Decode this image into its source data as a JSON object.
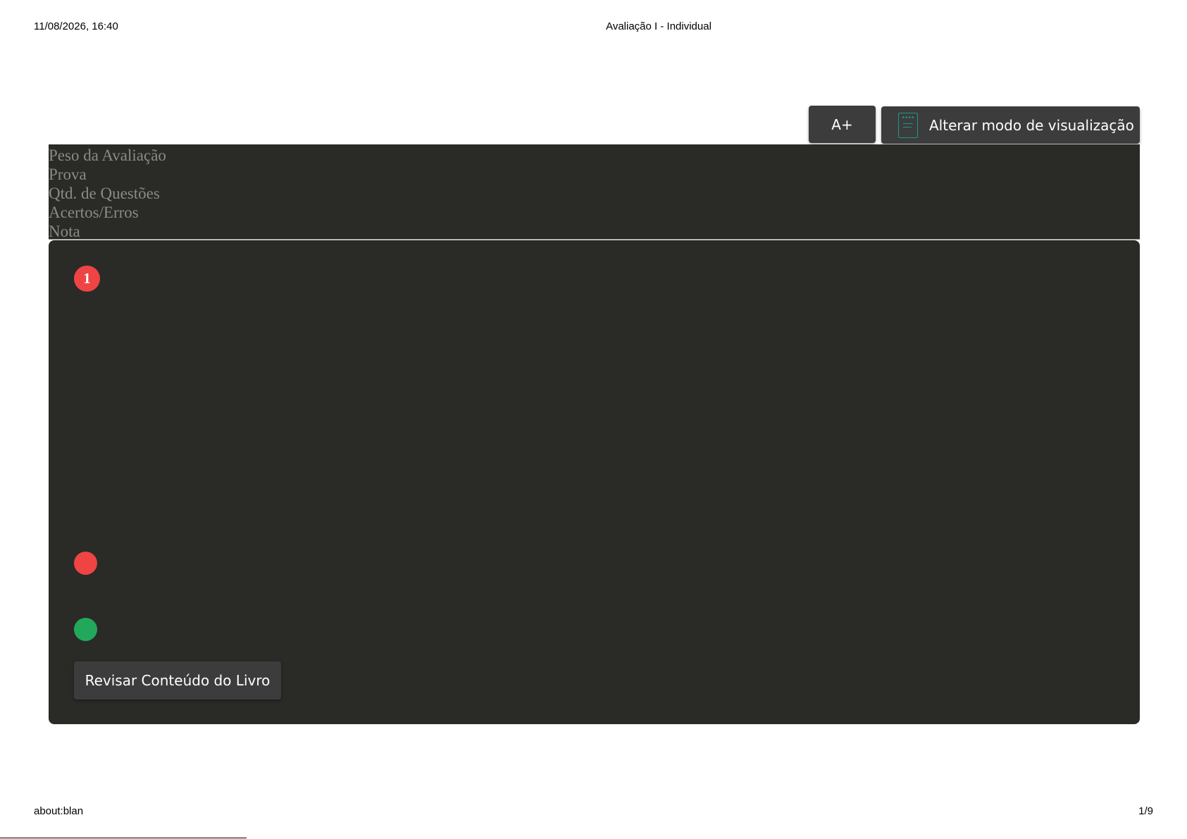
{
  "print_header": {
    "datetime": "11/08/2026, 16:40",
    "title": "Avaliação I - Individual"
  },
  "toolbar": {
    "font_size_label": "A+",
    "view_mode_label": "Alterar modo de visualização",
    "view_mode_icon": "document-icon",
    "icon_color": "#1a9a8a"
  },
  "info": {
    "labels": [
      "Peso da Avaliação",
      "Prova",
      "Qtd. de Questões",
      "Acertos/Erros",
      "Nota"
    ]
  },
  "question": {
    "number": "1",
    "number_color": "#ef4444",
    "incorrect_marker_color": "#ef4444",
    "correct_marker_color": "#22a85a",
    "review_button_label": "Revisar Conteúdo do Livro"
  },
  "print_footer": {
    "url": "about:blan",
    "page": "1/9"
  }
}
